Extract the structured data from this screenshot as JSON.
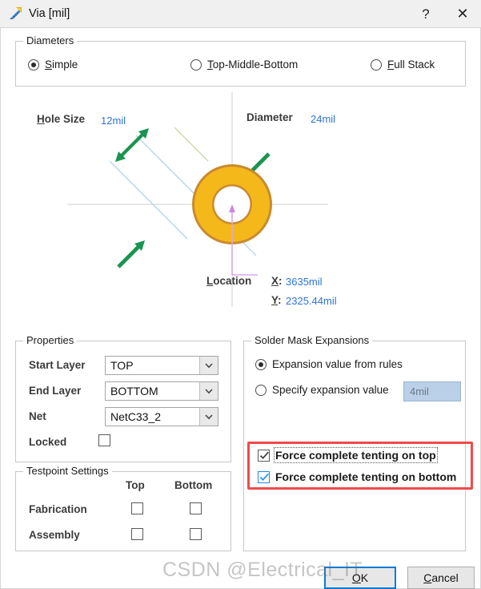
{
  "window": {
    "title": "Via [mil]",
    "icon": "via-ruler-icon",
    "help_label": "?",
    "close_label": "✕"
  },
  "diameters": {
    "group_title": "Diameters",
    "options": [
      {
        "label_pre": "",
        "accel": "S",
        "label_post": "imple",
        "selected": true,
        "name": "simple"
      },
      {
        "label_pre": "",
        "accel": "T",
        "label_post": "op-Middle-Bottom",
        "selected": false,
        "name": "top-middle-bottom"
      },
      {
        "label_pre": "",
        "accel": "F",
        "label_post": "ull Stack",
        "selected": false,
        "name": "full-stack"
      }
    ]
  },
  "graphic": {
    "hole_size_label_accel": "H",
    "hole_size_label_rest": "ole Size",
    "hole_size_value": "12mil",
    "diameter_label": "Diameter",
    "diameter_value": "24mil",
    "location_label_accel": "L",
    "location_label_rest": "ocation",
    "location_x_label": "X:",
    "location_x_value": "3635mil",
    "location_y_label": "Y:",
    "location_y_value": "2325.44mil",
    "via_fill_color": "#F5B81B",
    "via_ring_color": "#B87A2E",
    "arrow_color": "#1a9450",
    "guide_color": "#a9cfe5",
    "axis_color": "#cccccc",
    "location_line_color": "#d9a6e8"
  },
  "properties": {
    "group_title": "Properties",
    "start_layer_label": "Start Layer",
    "start_layer_value": "TOP",
    "end_layer_label": "End Layer",
    "end_layer_value": "BOTTOM",
    "net_label": "Net",
    "net_value": "NetC33_2",
    "locked_label": "Locked",
    "locked_checked": false
  },
  "testpoint": {
    "group_title": "Testpoint Settings",
    "col_top": "Top",
    "col_bottom": "Bottom",
    "rows": [
      {
        "label": "Fabrication",
        "top_checked": false,
        "bottom_checked": false
      },
      {
        "label": "Assembly",
        "top_checked": false,
        "bottom_checked": false
      }
    ]
  },
  "solder_mask": {
    "group_title": "Solder Mask Expansions",
    "option_from_rules": "Expansion value from rules",
    "option_specify": "Specify expansion value",
    "from_rules_selected": true,
    "specify_selected": false,
    "expansion_value": "4mil",
    "force_top_label": "Force complete tenting on top",
    "force_top_checked": true,
    "force_bottom_label": "Force complete tenting on bottom",
    "force_bottom_checked": true,
    "highlight_color": "#ef4b4b"
  },
  "footer": {
    "ok_label": "OK",
    "ok_accel": "O",
    "cancel_label": "Cancel",
    "cancel_accel": "C"
  },
  "watermark": {
    "text": "CSDN @Electrical_IT"
  }
}
